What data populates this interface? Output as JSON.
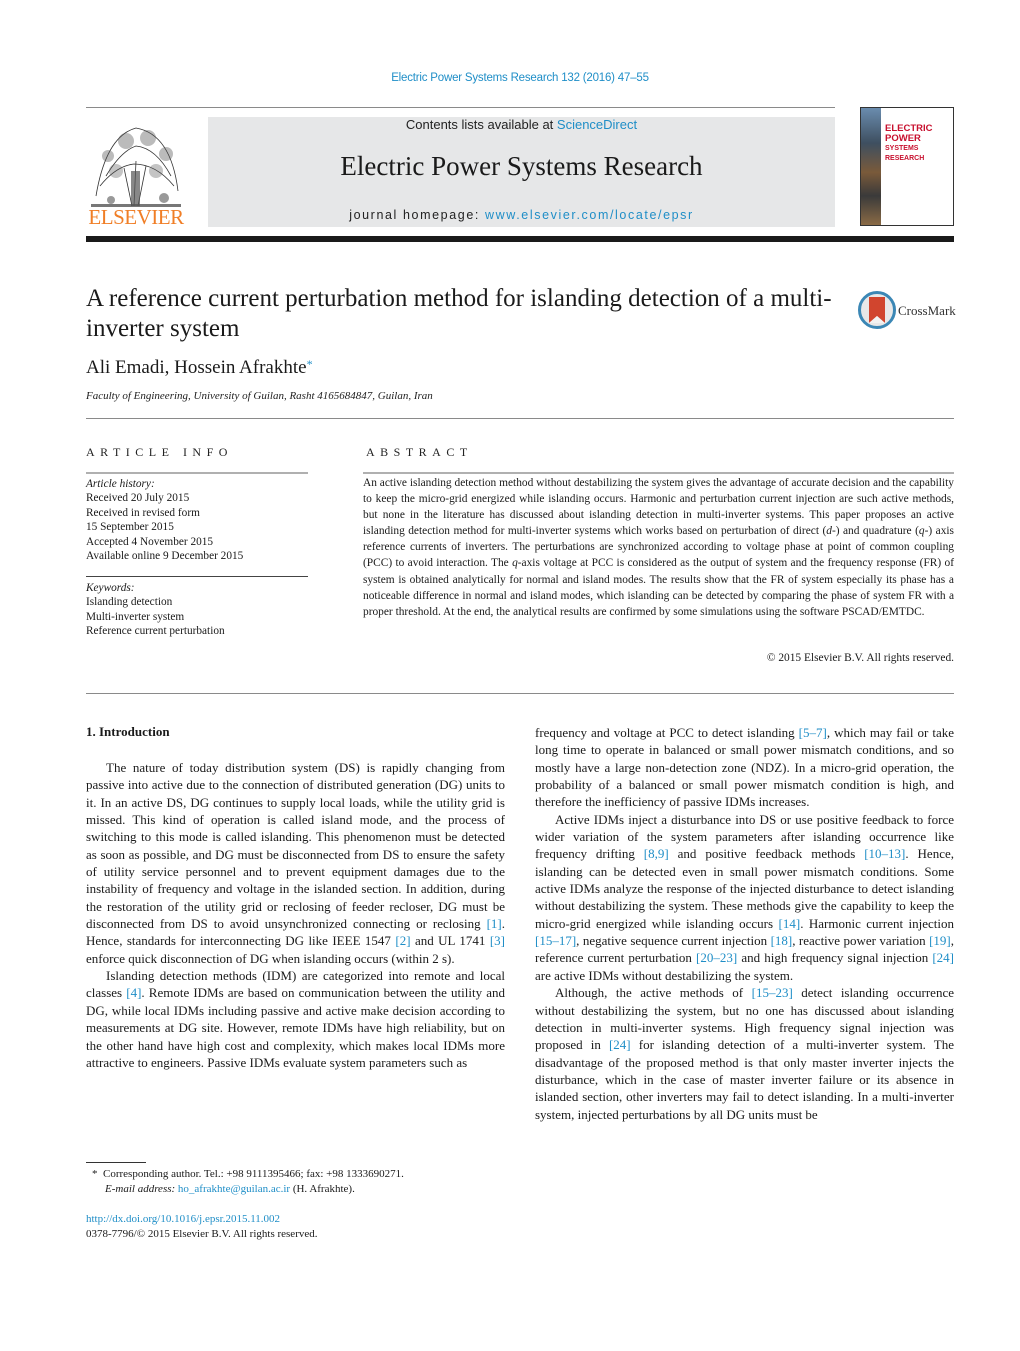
{
  "header": {
    "journal_ref": "Electric Power Systems Research 132 (2016) 47–55",
    "contents_prefix": "Contents lists available at ",
    "contents_link": "ScienceDirect",
    "journal_title": "Electric Power Systems Research",
    "homepage_prefix": "journal homepage: ",
    "homepage_link": "www.elsevier.com/locate/epsr",
    "publisher_logo_text": "ELSEVIER",
    "cover_title_line1": "ELECTRIC POWER",
    "cover_title_line2": "SYSTEMS RESEARCH",
    "colors": {
      "link": "#1f8ec7",
      "elsevier_orange": "#f07e26",
      "cover_red": "#c8102e"
    }
  },
  "article": {
    "title": "A reference current perturbation method for islanding detection of a multi-inverter system",
    "crossmark_label": "CrossMark",
    "authors": "Ali Emadi, Hossein Afrakhte",
    "corresponding_mark": "*",
    "affiliation": "Faculty of Engineering, University of Guilan, Rasht 4165684847, Guilan, Iran"
  },
  "article_info": {
    "heading": "ARTICLE INFO",
    "history_label": "Article history:",
    "history": [
      "Received 20 July 2015",
      "Received in revised form",
      "15 September 2015",
      "Accepted 4 November 2015",
      "Available online 9 December 2015"
    ],
    "keywords_label": "Keywords:",
    "keywords": [
      "Islanding detection",
      "Multi-inverter system",
      "Reference current perturbation"
    ]
  },
  "abstract": {
    "heading": "ABSTRACT",
    "text_1": "An active islanding detection method without destabilizing the system gives the advantage of accurate decision and the capability to keep the micro-grid energized while islanding occurs. Harmonic and perturbation current injection are such active methods, but none in the literature has discussed about islanding detection in multi-inverter systems. This paper proposes an active islanding detection method for multi-inverter systems which works based on perturbation of direct (",
    "d_italic": "d",
    "text_2": "-) and quadrature (",
    "q_italic": "q",
    "text_3": "-) axis reference currents of inverters. The perturbations are synchronized according to voltage phase at point of common coupling (PCC) to avoid interaction. The ",
    "q_italic_2": "q",
    "text_4": "-axis voltage at PCC is considered as the output of system and the frequency response (FR) of system is obtained analytically for normal and island modes. The results show that the FR of system especially its phase has a noticeable difference in normal and island modes, which islanding can be detected by comparing the phase of system FR with a proper threshold. At the end, the analytical results are confirmed by some simulations using the software PSCAD/EMTDC.",
    "copyright": "© 2015 Elsevier B.V. All rights reserved."
  },
  "body": {
    "section_heading": "1.  Introduction",
    "left_col": {
      "p1_a": "The nature of today distribution system (DS) is rapidly changing from passive into active due to the connection of distributed generation (DG) units to it. In an active DS, DG continues to supply local loads, while the utility grid is missed. This kind of operation is called island mode, and the process of switching to this mode is called islanding. This phenomenon must be detected as soon as possible, and DG must be disconnected from DS to ensure the safety of utility service personnel and to prevent equipment damages due to the instability of frequency and voltage in the islanded section. In addition, during the restoration of the utility grid or reclosing of feeder recloser, DG must be disconnected from DS to avoid unsynchronized connecting or reclosing ",
      "ref_1": "[1]",
      "p1_b": ". Hence, standards for interconnecting DG like IEEE 1547 ",
      "ref_2": "[2]",
      "p1_c": " and UL 1741 ",
      "ref_3": "[3]",
      "p1_d": " enforce quick disconnection of DG when islanding occurs (within 2 s).",
      "p2_a": "Islanding detection methods (IDM) are categorized into remote and local classes ",
      "ref_4": "[4]",
      "p2_b": ". Remote IDMs are based on communication between the utility and DG, while local IDMs including passive and active make decision according to measurements at DG site. However, remote IDMs have high reliability, but on the other hand have high cost and complexity, which makes local IDMs more attractive to engineers. Passive IDMs evaluate system parameters such as"
    },
    "right_col": {
      "p1_a": "frequency and voltage at PCC to detect islanding ",
      "ref_5_7": "[5–7]",
      "p1_b": ", which may fail or take long time to operate in balanced or small power mismatch conditions, and so mostly have a large non-detection zone (NDZ). In a micro-grid operation, the probability of a balanced or small power mismatch condition is high, and therefore the inefficiency of passive IDMs increases.",
      "p2_a": "Active IDMs inject a disturbance into DS or use positive feedback to force wider variation of the system parameters after islanding occurrence like frequency drifting ",
      "ref_8_9": "[8,9]",
      "p2_b": " and positive feedback methods ",
      "ref_10_13": "[10–13]",
      "p2_c": ". Hence, islanding can be detected even in small power mismatch conditions. Some active IDMs analyze the response of the injected disturbance to detect islanding without destabilizing the system. These methods give the capability to keep the micro-grid energized while islanding occurs ",
      "ref_14": "[14]",
      "p2_d": ". Harmonic current injection ",
      "ref_15_17": "[15–17]",
      "p2_e": ", negative sequence current injection ",
      "ref_18": "[18]",
      "p2_f": ", reactive power variation ",
      "ref_19": "[19]",
      "p2_g": ", reference current perturbation ",
      "ref_20_23": "[20–23]",
      "p2_h": " and high frequency signal injection ",
      "ref_24": "[24]",
      "p2_i": " are active IDMs without destabilizing the system.",
      "p3_a": "Although, the active methods of ",
      "ref_15_23": "[15–23]",
      "p3_b": " detect islanding occurrence without destabilizing the system, but no one has discussed about islanding detection in multi-inverter systems. High frequency signal injection was proposed in ",
      "ref_24b": "[24]",
      "p3_c": " for islanding detection of a multi-inverter system. The disadvantage of the proposed method is that only master inverter injects the disturbance, which in the case of master inverter failure or its absence in islanded section, other inverters may fail to detect islanding. In a multi-inverter system, injected perturbations by all DG units must be"
    }
  },
  "footnote": {
    "mark": "*",
    "line1": "Corresponding author. Tel.: +98 9111395466; fax: +98 1333690271.",
    "email_label": "E-mail address:",
    "email": "ho_afrakhte@guilan.ac.ir",
    "email_suffix": " (H. Afrakhte).",
    "doi_link": "http://dx.doi.org/10.1016/j.epsr.2015.11.002",
    "issn_line": "0378-7796/© 2015 Elsevier B.V. All rights reserved."
  }
}
